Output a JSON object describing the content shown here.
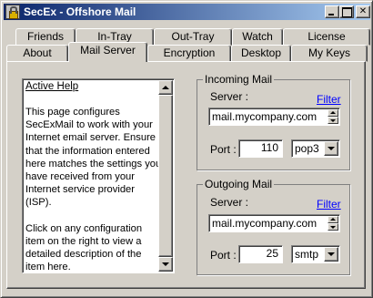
{
  "window": {
    "title": "SecEx - Offshore Mail"
  },
  "tabs": {
    "row_top": [
      "Friends",
      "In-Tray",
      "Out-Tray",
      "Watch",
      "License"
    ],
    "row_bottom": [
      "About",
      "Mail Server",
      "Encryption",
      "Desktop",
      "My Keys"
    ],
    "active": "Mail Server"
  },
  "help": {
    "title": "Active Help",
    "paragraph1": "This page configures SecExMail to work with your Internet email server. Ensure that the information entered here matches the settings you have received from your Internet service provider (ISP).",
    "paragraph2": "Click on any configuration item on the right to view a detailed description of the item here."
  },
  "incoming": {
    "legend": "Incoming Mail",
    "server_label": "Server :",
    "filter_label": "Filter",
    "server_value": "mail.mycompany.com",
    "port_label": "Port :",
    "port_value": "110",
    "protocol_value": "pop3"
  },
  "outgoing": {
    "legend": "Outgoing Mail",
    "server_label": "Server :",
    "filter_label": "Filter",
    "server_value": "mail.mycompany.com",
    "port_label": "Port :",
    "port_value": "25",
    "protocol_value": "smtp"
  },
  "colors": {
    "titlebar_start": "#0a246a",
    "titlebar_end": "#a6caf0",
    "face": "#d4d0c8",
    "link": "#0000ff"
  }
}
